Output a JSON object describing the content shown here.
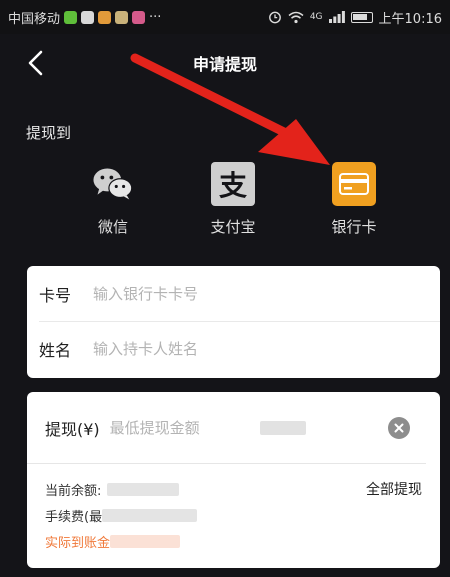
{
  "status_bar": {
    "carrier": "中国移动",
    "more": "···",
    "network": "4G",
    "time": "上午10:16"
  },
  "nav": {
    "title": "申请提现"
  },
  "withdraw_to": {
    "label": "提现到",
    "methods": [
      {
        "label": "微信",
        "icon": "wechat-icon"
      },
      {
        "label": "支付宝",
        "icon": "alipay-icon",
        "glyph": "支"
      },
      {
        "label": "银行卡",
        "icon": "bank-card-icon",
        "selected": true
      }
    ]
  },
  "card_form": {
    "card_label": "卡号",
    "card_placeholder": "输入银行卡卡号",
    "name_label": "姓名",
    "name_placeholder": "输入持卡人姓名"
  },
  "amount": {
    "label": "提现(¥)",
    "placeholder": "最低提现金额",
    "balance_label": "当前余额:",
    "withdraw_all": "全部提现",
    "fee_label": "手续费(最",
    "actual_label": "实际到账金"
  },
  "colors": {
    "background": "#141418",
    "accent_orange": "#f0a020",
    "arrow_red": "#e3231b",
    "highlight_text": "#f0793a"
  }
}
